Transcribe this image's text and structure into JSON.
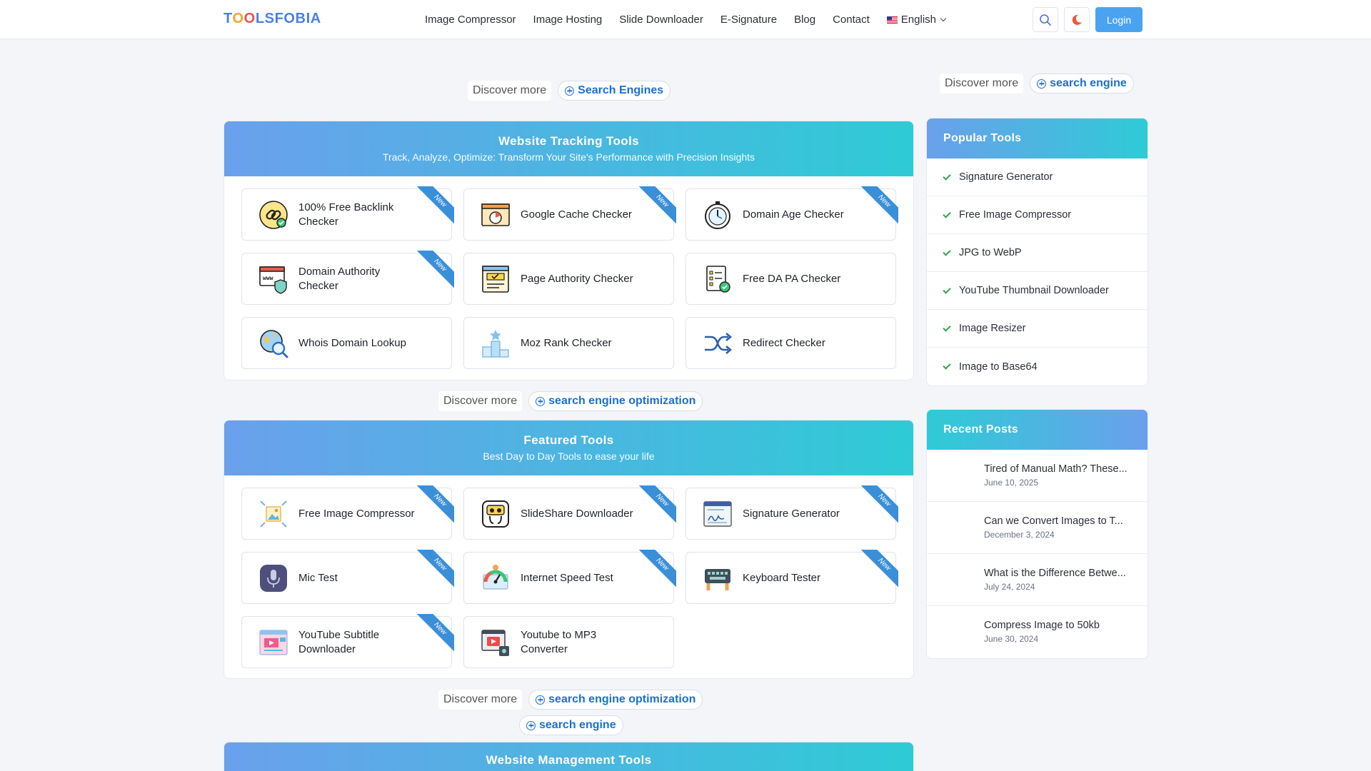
{
  "brand": {
    "logo_pre": "T",
    "logo_o1": "O",
    "logo_o2": "O",
    "logo_post": "LSFOBIA"
  },
  "nav": [
    {
      "label": "Image Compressor"
    },
    {
      "label": "Image Hosting"
    },
    {
      "label": "Slide Downloader"
    },
    {
      "label": "E-Signature"
    },
    {
      "label": "Blog"
    },
    {
      "label": "Contact"
    }
  ],
  "language": "English",
  "login_label": "Login",
  "discover": {
    "top_main": {
      "label": "Discover more",
      "pill": "Search Engines"
    },
    "top_side": {
      "label": "Discover more",
      "pill": "search engine"
    },
    "mid": {
      "label": "Discover more",
      "pill": "search engine optimization"
    },
    "bottom": {
      "label": "Discover more",
      "pill": "search engine optimization"
    },
    "bottom2": {
      "pill": "search engine"
    }
  },
  "ribbon_text": "New",
  "sections": [
    {
      "title": "Website Tracking Tools",
      "subtitle": "Track, Analyze, Optimize: Transform Your Site's Performance with Precision Insights",
      "tools": [
        {
          "label": "100% Free Backlink Checker",
          "icon": "link-icon",
          "new": true
        },
        {
          "label": "Google Cache Checker",
          "icon": "cache-browser-icon",
          "new": true
        },
        {
          "label": "Domain Age Checker",
          "icon": "stopwatch-icon",
          "new": true
        },
        {
          "label": "Domain Authority Checker",
          "icon": "www-shield-icon",
          "new": true
        },
        {
          "label": "Page Authority Checker",
          "icon": "page-check-icon",
          "new": false
        },
        {
          "label": "Free DA PA Checker",
          "icon": "checklist-icon",
          "new": false
        },
        {
          "label": "Whois Domain Lookup",
          "icon": "globe-search-icon",
          "new": false
        },
        {
          "label": "Moz Rank Checker",
          "icon": "podium-icon",
          "new": false
        },
        {
          "label": "Redirect Checker",
          "icon": "shuffle-icon",
          "new": false
        }
      ]
    },
    {
      "title": "Featured Tools",
      "subtitle": "Best Day to Day Tools to ease your life",
      "tools": [
        {
          "label": "Free Image Compressor",
          "icon": "image-compress-icon",
          "new": true
        },
        {
          "label": "SlideShare Downloader",
          "icon": "slideshare-icon",
          "new": true
        },
        {
          "label": "Signature Generator",
          "icon": "signature-icon",
          "new": true
        },
        {
          "label": "Mic Test",
          "icon": "microphone-icon",
          "new": true
        },
        {
          "label": "Internet Speed Test",
          "icon": "speedometer-icon",
          "new": true
        },
        {
          "label": "Keyboard Tester",
          "icon": "keyboard-icon",
          "new": true
        },
        {
          "label": "YouTube Subtitle Downloader",
          "icon": "subtitle-icon",
          "new": true
        },
        {
          "label": "Youtube to MP3 Converter",
          "icon": "video-mp3-icon",
          "new": false
        }
      ]
    },
    {
      "title": "Website Management Tools",
      "subtitle": "",
      "tools": []
    }
  ],
  "sidebar": {
    "popular_title": "Popular Tools",
    "popular": [
      "Signature Generator",
      "Free Image Compressor",
      "JPG to WebP",
      "YouTube Thumbnail Downloader",
      "Image Resizer",
      "Image to Base64"
    ],
    "recent_title": "Recent Posts",
    "recent": [
      {
        "title": "Tired of Manual Math? These...",
        "date": "June 10, 2025"
      },
      {
        "title": "Can we Convert Images to T...",
        "date": "December 3, 2024"
      },
      {
        "title": "What is the Difference Betwe...",
        "date": "July 24, 2024"
      },
      {
        "title": "Compress Image to 50kb",
        "date": "June 30, 2024"
      }
    ]
  },
  "colors": {
    "accent": "#4aa3f0",
    "link": "#1a6fd4",
    "gradient_start": "#6aa0ec",
    "gradient_end": "#2ecbd6",
    "ribbon": "#3a8fd9",
    "check": "#2aa84a"
  }
}
